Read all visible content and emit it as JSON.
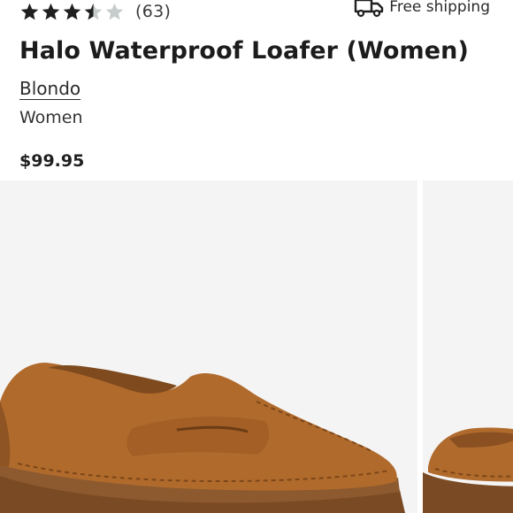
{
  "rating": {
    "value": 3.5,
    "max": 5,
    "count_label": "(63)"
  },
  "shipping": {
    "icon": "truck-icon",
    "label": "Free shipping"
  },
  "product": {
    "title": "Halo Waterproof Loafer (Women)",
    "brand": "Blondo",
    "department": "Women",
    "price": "$99.95"
  },
  "gallery": {
    "images": [
      "shoe-image-side",
      "shoe-image-next"
    ]
  },
  "colors": {
    "star_filled": "#1f1f1f",
    "star_empty": "#c6cccc",
    "image_bg": "#f4f4f4",
    "suede": "#b06a2c",
    "sole": "#7a4a24"
  }
}
